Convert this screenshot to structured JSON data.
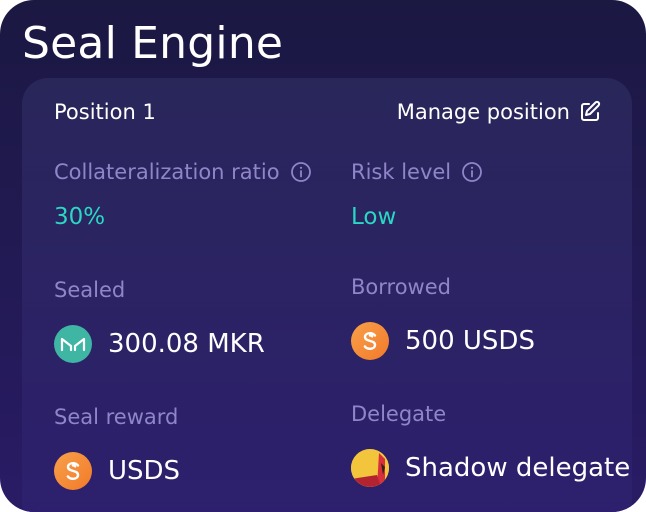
{
  "header": {
    "title": "Seal Engine"
  },
  "position": {
    "title": "Position 1",
    "manage_label": "Manage position"
  },
  "fields": {
    "collateralization": {
      "label": "Collateralization ratio",
      "value": "30%"
    },
    "risk": {
      "label": "Risk level",
      "value": "Low"
    },
    "sealed": {
      "label": "Sealed",
      "value": "300.08 MKR",
      "icon": "mkr-token-icon"
    },
    "borrowed": {
      "label": "Borrowed",
      "value": "500 USDS",
      "icon": "usds-token-icon"
    },
    "seal_reward": {
      "label": "Seal reward",
      "value": "USDS",
      "icon": "usds-token-icon"
    },
    "delegate": {
      "label": "Delegate",
      "value": "Shadow delegate",
      "icon": "delegate-avatar"
    }
  },
  "colors": {
    "background": "#1b1842",
    "card": "#2b2363",
    "label": "#8f86c9",
    "accent": "#2ad7c3",
    "text": "#ffffff"
  }
}
